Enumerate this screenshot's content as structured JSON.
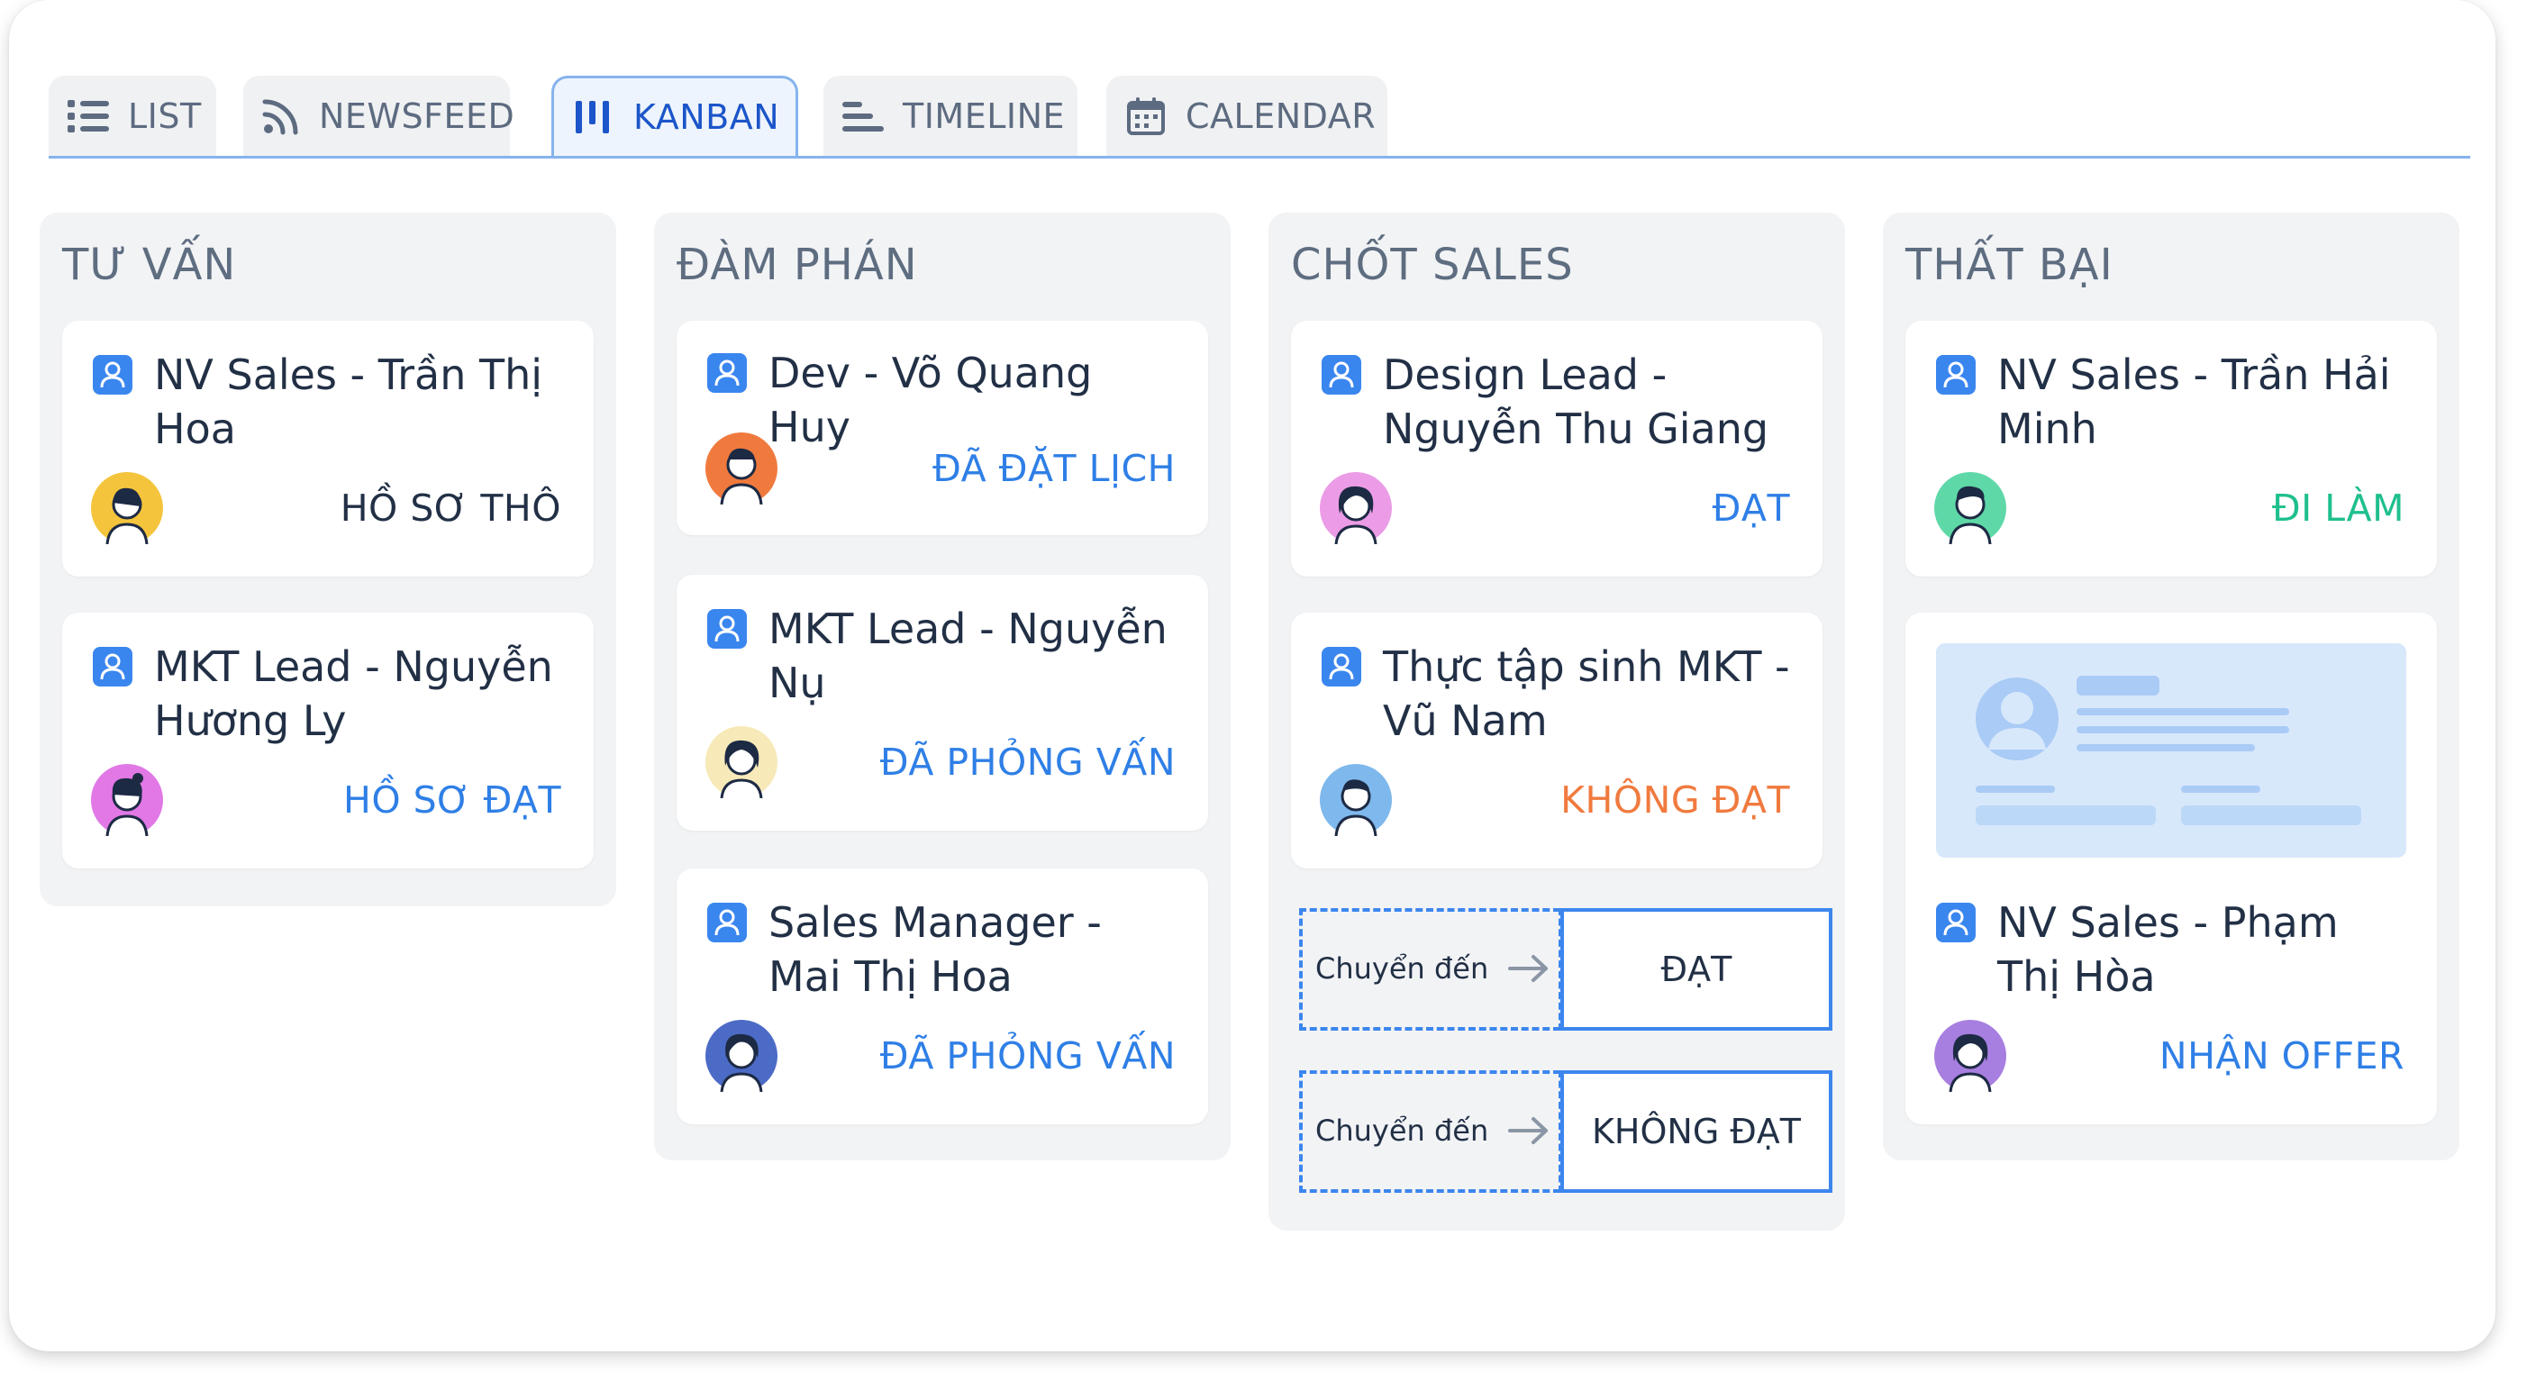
{
  "tabs": [
    {
      "label": "LIST",
      "icon": "list-icon",
      "active": false
    },
    {
      "label": "NEWSFEED",
      "icon": "rss-icon",
      "active": false
    },
    {
      "label": "KANBAN",
      "icon": "kanban-icon",
      "active": true
    },
    {
      "label": "TIMELINE",
      "icon": "timeline-icon",
      "active": false
    },
    {
      "label": "CALENDAR",
      "icon": "calendar-icon",
      "active": false
    }
  ],
  "columns": [
    {
      "title": "TƯ VẤN",
      "cards": [
        {
          "name": "NV Sales - Trần Thị Hoa",
          "status": "HỒ SƠ THÔ",
          "status_color": "#223046",
          "avatar_bg": "#f4c43c"
        },
        {
          "name": "MKT Lead - Nguyễn Hương Ly",
          "status": "HỒ SƠ ĐẠT",
          "status_color": "#2f7fe6",
          "avatar_bg": "#e178e6"
        }
      ]
    },
    {
      "title": "ĐÀM PHÁN",
      "cards": [
        {
          "name": "Dev - Võ Quang Huy",
          "status": "ĐÃ ĐẶT LỊCH",
          "status_color": "#2f7fe6",
          "avatar_bg": "#f07a3e"
        },
        {
          "name": "MKT Lead - Nguyễn Nụ",
          "status": "ĐÃ PHỎNG VẤN",
          "status_color": "#2f7fe6",
          "avatar_bg": "#f7e9b8"
        },
        {
          "name": "Sales Manager - Mai Thị Hoa",
          "status": "ĐÃ PHỎNG VẤN",
          "status_color": "#2f7fe6",
          "avatar_bg": "#4c6bc6"
        }
      ]
    },
    {
      "title": "CHỐT SALES",
      "cards": [
        {
          "name": "Design Lead - Nguyễn Thu Giang",
          "status": "ĐẠT",
          "status_color": "#2f7fe6",
          "avatar_bg": "#ec9ce6"
        },
        {
          "name": "Thực tập sinh MKT - Vũ Nam",
          "status": "KHÔNG ĐẠT",
          "status_color": "#f07a3e",
          "avatar_bg": "#7fb8ec"
        }
      ],
      "drop_zones": [
        {
          "label": "Chuyển đến",
          "target": "ĐẠT"
        },
        {
          "label": "Chuyển đến",
          "target": "KHÔNG ĐẠT"
        }
      ]
    },
    {
      "title": "THẤT BẠI",
      "cards": [
        {
          "name": "NV Sales - Trần Hải Minh",
          "status": "ĐI LÀM",
          "status_color": "#1fbf8e",
          "avatar_bg": "#5fd8a8"
        },
        {
          "name": "NV Sales - Phạm Thị Hòa",
          "status": "NHẬN OFFER",
          "status_color": "#2f7fe6",
          "avatar_bg": "#a77fe0"
        }
      ]
    }
  ],
  "colors": {
    "accent": "#3c86ee",
    "column_bg": "#f2f3f5",
    "text_dark": "#223046"
  }
}
